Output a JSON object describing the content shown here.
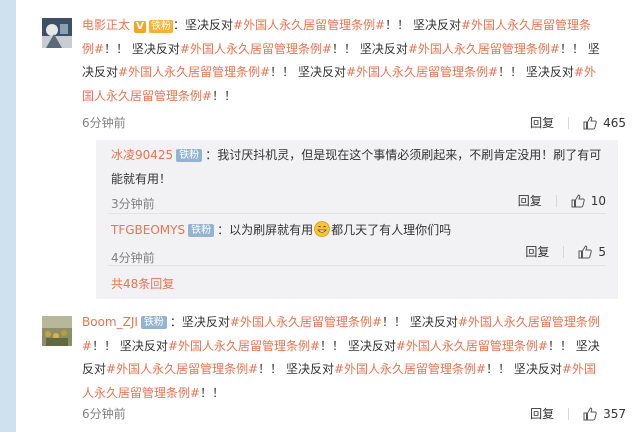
{
  "comments": [
    {
      "user": "电影正太",
      "vip_label": "V",
      "iron_label": "铁粉",
      "segments": [
        {
          "t": "：坚决反对",
          "h": false
        },
        {
          "t": "#外国人永久居留管理条例#",
          "h": true
        },
        {
          "t": "！！ 坚决反对",
          "h": false
        },
        {
          "t": "#外国人永久居留管理条例#",
          "h": true
        },
        {
          "t": "！！ 坚决反对",
          "h": false
        },
        {
          "t": "#外国人永久居留管理条例#",
          "h": true
        },
        {
          "t": "！！ 坚决反对",
          "h": false
        },
        {
          "t": "#外国人永久居留管理条例#",
          "h": true
        },
        {
          "t": "！！ 坚决反对",
          "h": false
        },
        {
          "t": "#外国人永久居留管理条例#",
          "h": true
        },
        {
          "t": "！！ 坚决反对",
          "h": false
        },
        {
          "t": "#外国人永久居留管理条例#",
          "h": true
        },
        {
          "t": "！！ 坚决反对",
          "h": false
        },
        {
          "t": "#外国人永久居留管理条例#",
          "h": true
        },
        {
          "t": "！！",
          "h": false
        }
      ],
      "time": "6分钟前",
      "reply_label": "回复",
      "likes": "465"
    },
    {
      "user": "Boom_ZJI",
      "badge": "铁粉",
      "segments": [
        {
          "t": "：坚决反对",
          "h": false
        },
        {
          "t": "#外国人永久居留管理条例#",
          "h": true
        },
        {
          "t": "！！ 坚决反对",
          "h": false
        },
        {
          "t": "#外国人永久居留管理条例#",
          "h": true
        },
        {
          "t": "！！ 坚决反对",
          "h": false
        },
        {
          "t": "#外国人永久居留管理条例#",
          "h": true
        },
        {
          "t": "！！ 坚决反对",
          "h": false
        },
        {
          "t": "#外国人永久居留管理条例#",
          "h": true
        },
        {
          "t": "！！ 坚决反对",
          "h": false
        },
        {
          "t": "#外国人永久居留管理条例#",
          "h": true
        },
        {
          "t": "！！ 坚决反对",
          "h": false
        },
        {
          "t": "#外国人永久居留管理条例#",
          "h": true
        },
        {
          "t": "！！ 坚决反对",
          "h": false
        },
        {
          "t": "#外国人永久居留管理条例#",
          "h": true
        },
        {
          "t": "！！",
          "h": false
        }
      ],
      "time": "6分钟前",
      "reply_label": "回复",
      "likes": "357"
    }
  ],
  "replies": [
    {
      "user": "冰凌90425",
      "badge": "铁粉",
      "text": "：我讨厌抖机灵，但是现在这个事情必须刷起来，不刷肯定没用！刷了有可能就有用！",
      "time": "3分钟前",
      "reply_label": "回复",
      "likes": "10"
    },
    {
      "user": "TFGBEOMYS",
      "badge": "铁粉",
      "text_before": "：以为刷屏就有用",
      "emoji_name": "grin-emoji",
      "text_after": "都几天了有人理你们吗",
      "time": "4分钟前",
      "reply_label": "回复",
      "likes": "5"
    }
  ],
  "more_replies": "共48条回复",
  "colors": {
    "accent": "#eb7350",
    "badge": "#94b3d1",
    "background": "#cfe1ee",
    "sub_background": "#f2f2f5"
  }
}
